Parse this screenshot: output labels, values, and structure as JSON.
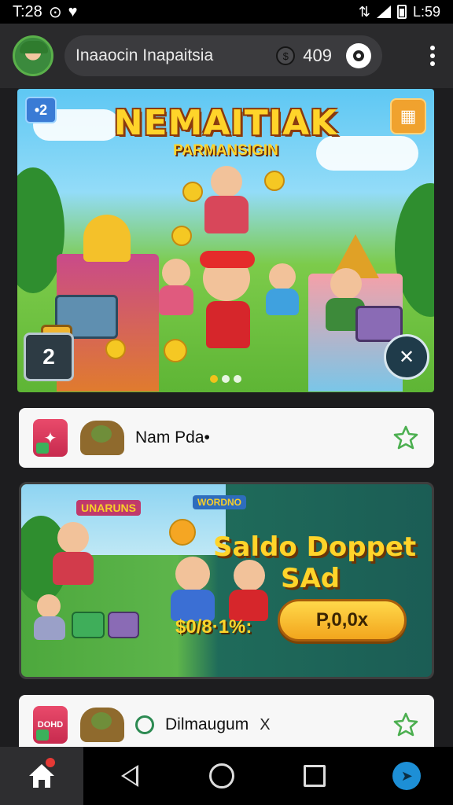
{
  "status_bar": {
    "time": "T:28",
    "time_right": "L:59",
    "icons": [
      "notification-icon",
      "heart-icon",
      "vibrate-icon",
      "wifi-icon",
      "signal-icon",
      "battery-icon"
    ]
  },
  "header": {
    "search_text": "Inaaocin Inapaitsia",
    "coin_count": "409",
    "coin_icon": "coin-icon",
    "target_icon": "target-icon",
    "menu_icon": "more-vertical-icon"
  },
  "hero": {
    "title": "NEMAITIAK",
    "subtitle": "PARMANSIGIN",
    "badge_top_left": "•2",
    "badge_bottom_left": "2",
    "badge_bottom_right": "✕",
    "carousel_dots": 3,
    "carousel_active": 0
  },
  "card1": {
    "label": "Nam Pda•"
  },
  "promo": {
    "logo1": "UNARUNS",
    "logo2": "WORDNO",
    "title": "Saldo Doppet",
    "subtitle": "SAd",
    "price": "$0/8·1%:",
    "button_label": "P,0,0x"
  },
  "card2": {
    "badge": "DOHD",
    "label": "Dilmaugum",
    "extra": "X"
  },
  "bottom_nav": {
    "items": [
      "home",
      "back",
      "home-circle",
      "recents",
      "send"
    ]
  },
  "colors": {
    "accent_gold": "#ffd42a",
    "nav_accent": "#1d8fd6",
    "star_green": "#4caf50",
    "notification_red": "#e53935"
  }
}
